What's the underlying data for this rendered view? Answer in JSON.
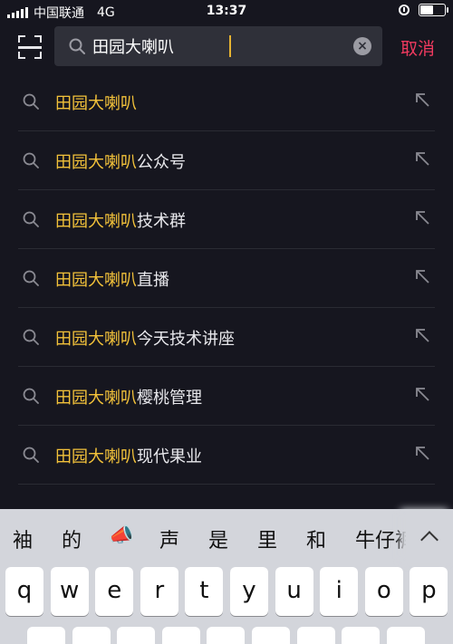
{
  "status": {
    "carrier": "中国联通",
    "network": "4G",
    "time": "13:37",
    "battery_level": 0.55
  },
  "search": {
    "query": "田园大喇叭",
    "cancel_label": "取消"
  },
  "suggestions": [
    {
      "highlight": "田园大喇叭",
      "rest": ""
    },
    {
      "highlight": "田园大喇叭",
      "rest": "公众号"
    },
    {
      "highlight": "田园大喇叭",
      "rest": "技术群"
    },
    {
      "highlight": "田园大喇叭",
      "rest": "直播"
    },
    {
      "highlight": "田园大喇叭",
      "rest": "今天技术讲座"
    },
    {
      "highlight": "田园大喇叭",
      "rest": "樱桃管理"
    },
    {
      "highlight": "田园大喇叭",
      "rest": "现代果业"
    }
  ],
  "keyboard": {
    "candidates": [
      "袖",
      "的",
      "📣",
      "声",
      "是",
      "里",
      "和",
      "牛仔裤"
    ],
    "row1": [
      "q",
      "w",
      "e",
      "r",
      "t",
      "y",
      "u",
      "i",
      "o",
      "p"
    ]
  }
}
